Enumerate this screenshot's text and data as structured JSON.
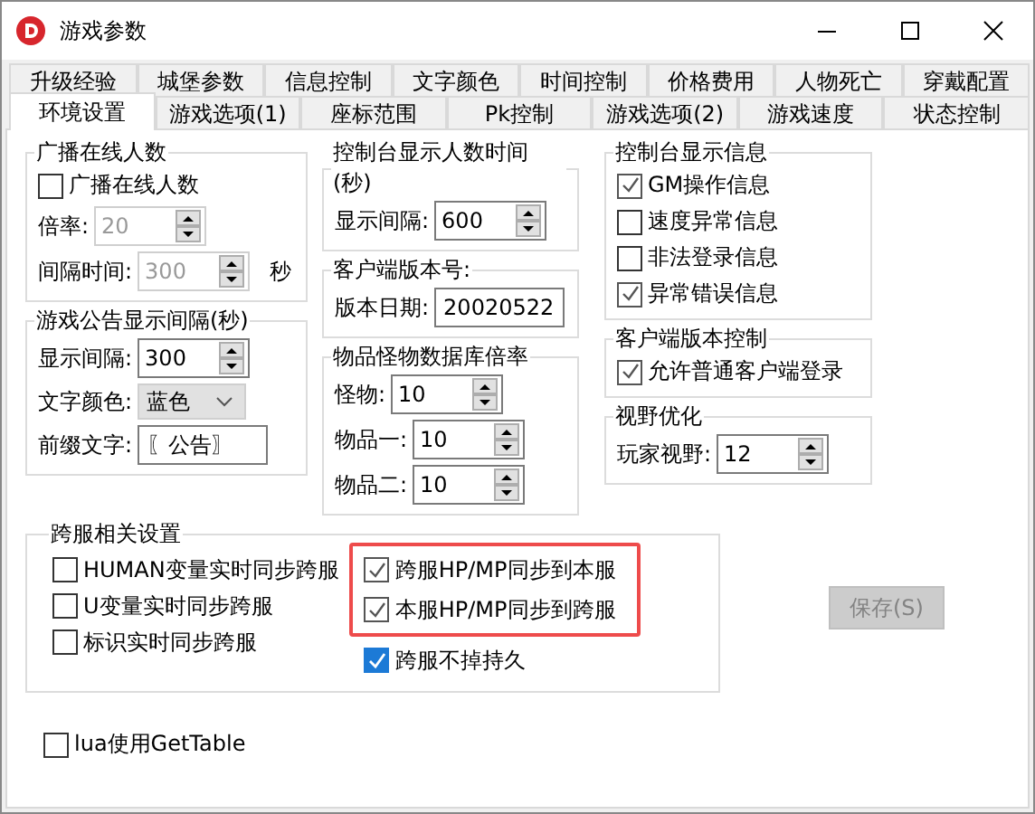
{
  "window": {
    "title": "游戏参数"
  },
  "tab_rows": [
    {
      "tabs": [
        {
          "label": "升级经验",
          "selected": false
        },
        {
          "label": "城堡参数",
          "selected": false
        },
        {
          "label": "信息控制",
          "selected": false
        },
        {
          "label": "文字颜色",
          "selected": false
        },
        {
          "label": "时间控制",
          "selected": false
        },
        {
          "label": "价格费用",
          "selected": false
        },
        {
          "label": "人物死亡",
          "selected": false
        },
        {
          "label": "穿戴配置",
          "selected": false
        }
      ]
    },
    {
      "tabs": [
        {
          "label": "环境设置",
          "selected": true
        },
        {
          "label": "游戏选项(1)",
          "selected": false
        },
        {
          "label": "座标范围",
          "selected": false
        },
        {
          "label": "Pk控制",
          "selected": false
        },
        {
          "label": "游戏选项(2)",
          "selected": false
        },
        {
          "label": "游戏速度",
          "selected": false
        },
        {
          "label": "状态控制",
          "selected": false
        }
      ]
    }
  ],
  "columns": [
    {
      "groups": [
        {
          "title": "广播在线人数",
          "rows": [
            {
              "kind": "checkbox",
              "label": "广播在线人数",
              "checked": false
            },
            {
              "kind": "spin",
              "label": "倍率:",
              "value": "20",
              "disabled": true
            },
            {
              "kind": "spin",
              "label": "间隔时间:",
              "value": "300",
              "disabled": true,
              "unit": "秒"
            }
          ]
        },
        {
          "title": "游戏公告显示间隔(秒)",
          "rows": [
            {
              "kind": "spin",
              "label": "显示间隔:",
              "value": "300",
              "disabled": false
            },
            {
              "kind": "select",
              "label": "文字颜色:",
              "value": "蓝色"
            },
            {
              "kind": "text",
              "label": "前缀文字:",
              "value": "〖公告〗"
            }
          ]
        }
      ]
    },
    {
      "groups": [
        {
          "title": "控制台显示人数时间(秒)",
          "rows": [
            {
              "kind": "spin",
              "label": "显示间隔:",
              "value": "600",
              "disabled": false
            }
          ]
        },
        {
          "title": "客户端版本号:",
          "rows": [
            {
              "kind": "text",
              "label": "版本日期:",
              "value": "20020522"
            }
          ]
        },
        {
          "title": "物品怪物数据库倍率",
          "rows": [
            {
              "kind": "spin",
              "label": "怪物:",
              "value": "10",
              "disabled": false
            },
            {
              "kind": "spin",
              "label": "物品一:",
              "value": "10",
              "disabled": false
            },
            {
              "kind": "spin",
              "label": "物品二:",
              "value": "10",
              "disabled": false
            }
          ]
        }
      ]
    },
    {
      "groups": [
        {
          "title": "控制台显示信息",
          "rows": [
            {
              "kind": "checkbox",
              "label": "GM操作信息",
              "checked": true
            },
            {
              "kind": "checkbox",
              "label": "速度异常信息",
              "checked": false
            },
            {
              "kind": "checkbox",
              "label": "非法登录信息",
              "checked": false
            },
            {
              "kind": "checkbox",
              "label": "异常错误信息",
              "checked": true
            }
          ]
        },
        {
          "title": "客户端版本控制",
          "rows": [
            {
              "kind": "checkbox",
              "label": "允许普通客户端登录",
              "checked": true
            }
          ]
        },
        {
          "title": "视野优化",
          "rows": [
            {
              "kind": "spin",
              "label": "玩家视野:",
              "value": "12",
              "disabled": false
            }
          ]
        }
      ]
    }
  ],
  "cross_server": {
    "title": "跨服相关设置",
    "left": [
      {
        "label": "HUMAN变量实时同步跨服",
        "checked": false
      },
      {
        "label": "U变量实时同步跨服",
        "checked": false
      },
      {
        "label": "标识实时同步跨服",
        "checked": false
      }
    ],
    "highlighted": [
      {
        "label": "跨服HP/MP同步到本服",
        "checked": true
      },
      {
        "label": "本服HP/MP同步到跨服",
        "checked": true
      }
    ],
    "right": [
      {
        "label": "跨服不掉持久",
        "checked": true
      }
    ]
  },
  "save_button": {
    "label": "保存(S)",
    "disabled": true
  },
  "bottom_checkbox": {
    "label": "lua使用GetTable",
    "checked": false
  }
}
